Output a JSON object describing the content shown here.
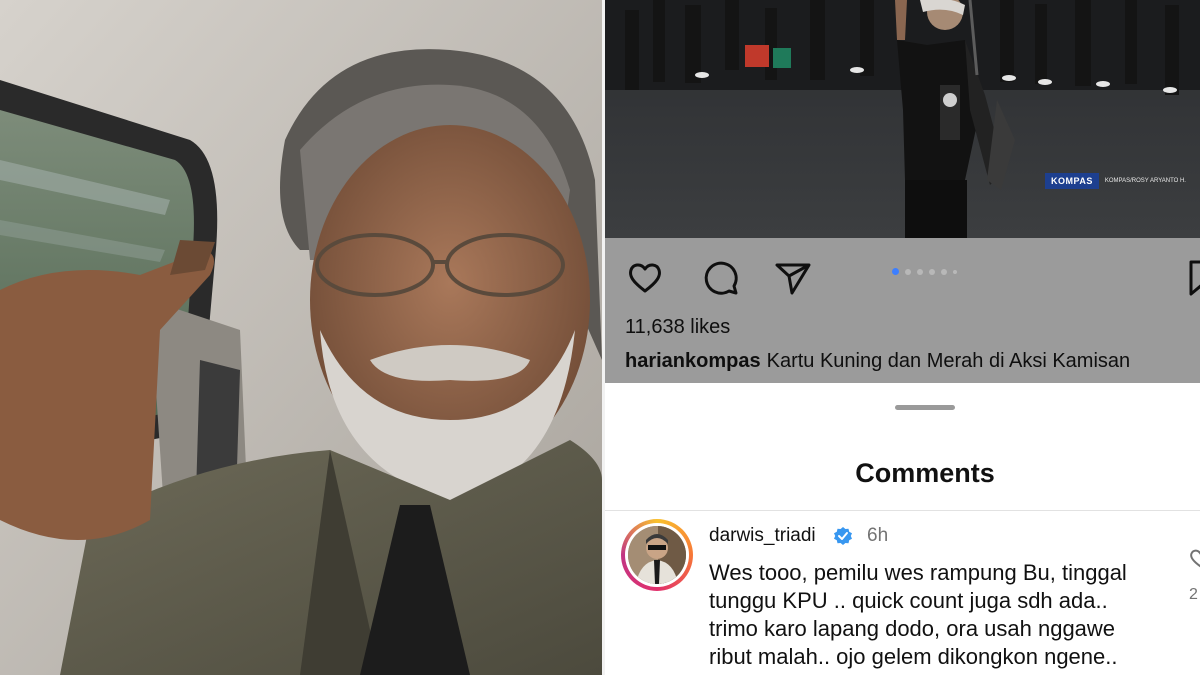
{
  "post": {
    "likes": "11,638 likes",
    "caption_user": "hariankompas",
    "caption_text": "Kartu Kuning dan Merah di Aksi Kamisan",
    "watermark_logo": "KOMPAS",
    "watermark_credit": "KOMPAS/ROSY ARYANTO H."
  },
  "actions": {
    "icons": [
      "heart-icon",
      "comment-icon",
      "share-icon",
      "bookmark-icon"
    ],
    "carousel_dots": 6,
    "carousel_active_index": 0
  },
  "comments": {
    "title": "Comments",
    "items": [
      {
        "username": "darwis_triadi",
        "verified": true,
        "time": "6h",
        "lines": [
          "Wes tooo, pemilu wes rampung  Bu, tinggal",
          "tunggu KPU .. quick count juga sdh ada..",
          "trimo karo lapang dodo, ora usah nggawe",
          "ribut malah.. ojo gelem dikongkon ngene.."
        ],
        "like_count": "2"
      }
    ]
  },
  "colors": {
    "action_bar_bg": "#9b9b9b",
    "active_dot": "#3d7fff",
    "verified_badge": "#3897f0",
    "watermark_bg": "#1d3f8f"
  }
}
